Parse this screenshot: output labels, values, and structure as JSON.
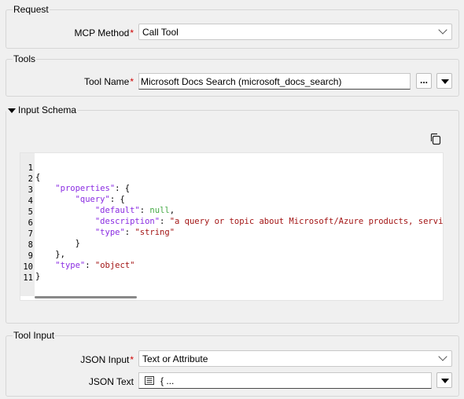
{
  "request": {
    "legend": "Request",
    "method_label": "MCP Method",
    "method_value": "Call Tool"
  },
  "tools": {
    "legend": "Tools",
    "name_label": "Tool Name",
    "name_value": "Microsoft Docs Search (microsoft_docs_search)",
    "browse_label": "..."
  },
  "schema": {
    "legend": "Input Schema",
    "lines": [
      {
        "n": "1"
      },
      {
        "n": "2"
      },
      {
        "n": "3"
      },
      {
        "n": "4"
      },
      {
        "n": "5"
      },
      {
        "n": "6"
      },
      {
        "n": "7"
      },
      {
        "n": "8"
      },
      {
        "n": "9"
      },
      {
        "n": "10"
      },
      {
        "n": "11"
      }
    ],
    "tokens": {
      "brace_open": "{",
      "brace_close": "}",
      "properties": "\"properties\"",
      "query": "\"query\"",
      "default": "\"default\"",
      "null": "null",
      "description": "\"description\"",
      "description_value": "\"a query or topic about Microsoft/Azure products, services,",
      "type": "\"type\"",
      "string": "\"string\"",
      "object": "\"object\"",
      "colon_brace": ": {",
      "colon": ": ",
      "comma": ",",
      "close_brace": "}",
      "close_brace_comma": "},"
    }
  },
  "tool_input": {
    "legend": "Tool Input",
    "json_input_label": "JSON Input",
    "json_input_value": "Text or Attribute",
    "json_text_label": "JSON Text",
    "json_text_value": "{ ..."
  }
}
